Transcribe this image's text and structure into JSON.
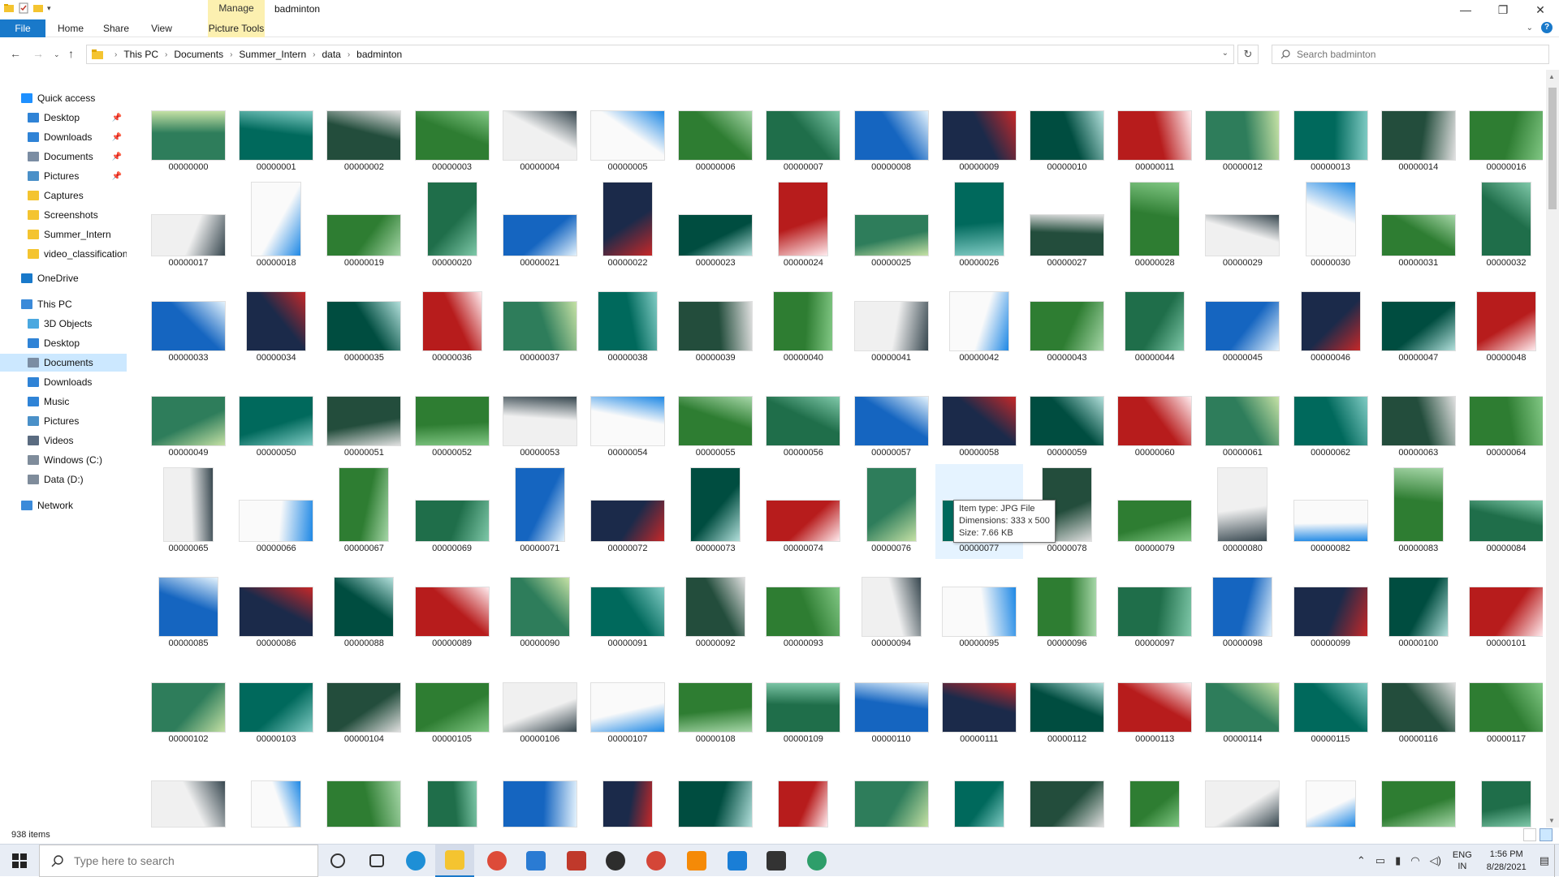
{
  "window": {
    "title": "badminton",
    "manage_label": "Manage",
    "picture_tools_label": "Picture Tools",
    "minimize": "—",
    "maximize": "❐",
    "close": "✕"
  },
  "ribbon": {
    "tabs": [
      "File",
      "Home",
      "Share",
      "View"
    ],
    "picture_tools": "Picture Tools",
    "help": "?"
  },
  "address": {
    "breadcrumbs": [
      "This PC",
      "Documents",
      "Summer_Intern",
      "data",
      "badminton"
    ],
    "search_placeholder": "Search badminton"
  },
  "sidebar": {
    "items": [
      {
        "label": "Quick access",
        "icon": "star-icon",
        "color": "#1e90ff",
        "level": 0,
        "pinned": false
      },
      {
        "label": "Desktop",
        "icon": "desktop-icon",
        "color": "#2f83d6",
        "level": 1,
        "pinned": true
      },
      {
        "label": "Downloads",
        "icon": "download-icon",
        "color": "#2f83d6",
        "level": 1,
        "pinned": true
      },
      {
        "label": "Documents",
        "icon": "documents-icon",
        "color": "#7b8da3",
        "level": 1,
        "pinned": true
      },
      {
        "label": "Pictures",
        "icon": "pictures-icon",
        "color": "#4a90c8",
        "level": 1,
        "pinned": true
      },
      {
        "label": "Captures",
        "icon": "folder-icon",
        "color": "#f4c430",
        "level": 1,
        "pinned": false
      },
      {
        "label": "Screenshots",
        "icon": "folder-icon",
        "color": "#f4c430",
        "level": 1,
        "pinned": false
      },
      {
        "label": "Summer_Intern",
        "icon": "folder-icon",
        "color": "#f4c430",
        "level": 1,
        "pinned": false
      },
      {
        "label": "video_classification",
        "icon": "folder-icon",
        "color": "#f4c430",
        "level": 1,
        "pinned": false
      },
      {
        "label": "OneDrive",
        "icon": "cloud-icon",
        "color": "#1979ca",
        "level": 0,
        "pinned": false
      },
      {
        "label": "This PC",
        "icon": "computer-icon",
        "color": "#3b8ad9",
        "level": 0,
        "pinned": false
      },
      {
        "label": "3D Objects",
        "icon": "cube-icon",
        "color": "#4aa8e0",
        "level": 1,
        "pinned": false
      },
      {
        "label": "Desktop",
        "icon": "desktop-icon",
        "color": "#2f83d6",
        "level": 1,
        "pinned": false
      },
      {
        "label": "Documents",
        "icon": "documents-icon",
        "color": "#7b8da3",
        "level": 1,
        "pinned": false,
        "selected": true
      },
      {
        "label": "Downloads",
        "icon": "download-icon",
        "color": "#2f83d6",
        "level": 1,
        "pinned": false
      },
      {
        "label": "Music",
        "icon": "music-icon",
        "color": "#2f83d6",
        "level": 1,
        "pinned": false
      },
      {
        "label": "Pictures",
        "icon": "pictures-icon",
        "color": "#4a90c8",
        "level": 1,
        "pinned": false
      },
      {
        "label": "Videos",
        "icon": "video-icon",
        "color": "#5a6b80",
        "level": 1,
        "pinned": false
      },
      {
        "label": "Windows (C:)",
        "icon": "drive-icon",
        "color": "#7f8c9b",
        "level": 1,
        "pinned": false
      },
      {
        "label": "Data (D:)",
        "icon": "drive-icon",
        "color": "#7f8c9b",
        "level": 1,
        "pinned": false
      },
      {
        "label": "Network",
        "icon": "network-icon",
        "color": "#3b8ad9",
        "level": 0,
        "pinned": false
      }
    ]
  },
  "files": [
    [
      "00000000",
      "00000001",
      "00000002",
      "00000003",
      "00000004",
      "00000005",
      "00000006",
      "00000007",
      "00000008",
      "00000009",
      "00000010",
      "00000011",
      "00000012",
      "00000013",
      "00000014",
      "00000016"
    ],
    [
      "00000017",
      "00000018",
      "00000019",
      "00000020",
      "00000021",
      "00000022",
      "00000023",
      "00000024",
      "00000025",
      "00000026",
      "00000027",
      "00000028",
      "00000029",
      "00000030",
      "00000031",
      "00000032"
    ],
    [
      "00000033",
      "00000034",
      "00000035",
      "00000036",
      "00000037",
      "00000038",
      "00000039",
      "00000040",
      "00000041",
      "00000042",
      "00000043",
      "00000044",
      "00000045",
      "00000046",
      "00000047",
      "00000048"
    ],
    [
      "00000049",
      "00000050",
      "00000051",
      "00000052",
      "00000053",
      "00000054",
      "00000055",
      "00000056",
      "00000057",
      "00000058",
      "00000059",
      "00000060",
      "00000061",
      "00000062",
      "00000063",
      "00000064"
    ],
    [
      "00000065",
      "00000066",
      "00000067",
      "00000069",
      "00000071",
      "00000072",
      "00000073",
      "00000074",
      "00000076",
      "00000077",
      "00000078",
      "00000079",
      "00000080",
      "00000082",
      "00000083",
      "00000084"
    ],
    [
      "00000085",
      "00000086",
      "00000088",
      "00000089",
      "00000090",
      "00000091",
      "00000092",
      "00000093",
      "00000094",
      "00000095",
      "00000096",
      "00000097",
      "00000098",
      "00000099",
      "00000100",
      "00000101"
    ],
    [
      "00000102",
      "00000103",
      "00000104",
      "00000105",
      "00000106",
      "00000107",
      "00000108",
      "00000109",
      "00000110",
      "00000111",
      "00000112",
      "00000113",
      "00000114",
      "00000115",
      "00000116",
      "00000117"
    ],
    [
      "",
      "",
      "",
      "",
      "",
      "",
      "",
      "",
      "",
      "",
      "",
      "",
      "",
      "",
      "",
      ""
    ]
  ],
  "tooltip": {
    "type": "Item type: JPG File",
    "dimensions": "Dimensions: 333 x 500",
    "size": "Size: 7.66 KB"
  },
  "status": {
    "item_count": "938 items"
  },
  "taskbar": {
    "search_placeholder": "Type here to search",
    "language": "ENG",
    "region": "IN",
    "time": "1:56 PM",
    "date": "8/28/2021",
    "apps": [
      {
        "name": "cortana-icon",
        "color": "#333333"
      },
      {
        "name": "task-view-icon",
        "color": "#333333"
      },
      {
        "name": "edge-icon",
        "color": "#1e8fd6"
      },
      {
        "name": "file-explorer-icon",
        "color": "#f4c430"
      },
      {
        "name": "chrome-icon",
        "color": "#dd4b39"
      },
      {
        "name": "mail-icon",
        "color": "#2a7bd3"
      },
      {
        "name": "game-icon",
        "color": "#c0392b"
      },
      {
        "name": "xbox-icon",
        "color": "#2d2d2d"
      },
      {
        "name": "chrome-profile-icon",
        "color": "#d44638"
      },
      {
        "name": "sublime-icon",
        "color": "#f58a07"
      },
      {
        "name": "vscode-icon",
        "color": "#1a7ed6"
      },
      {
        "name": "pubg-icon",
        "color": "#333333"
      },
      {
        "name": "chatgpt-icon",
        "color": "#2e9e6a"
      }
    ]
  }
}
